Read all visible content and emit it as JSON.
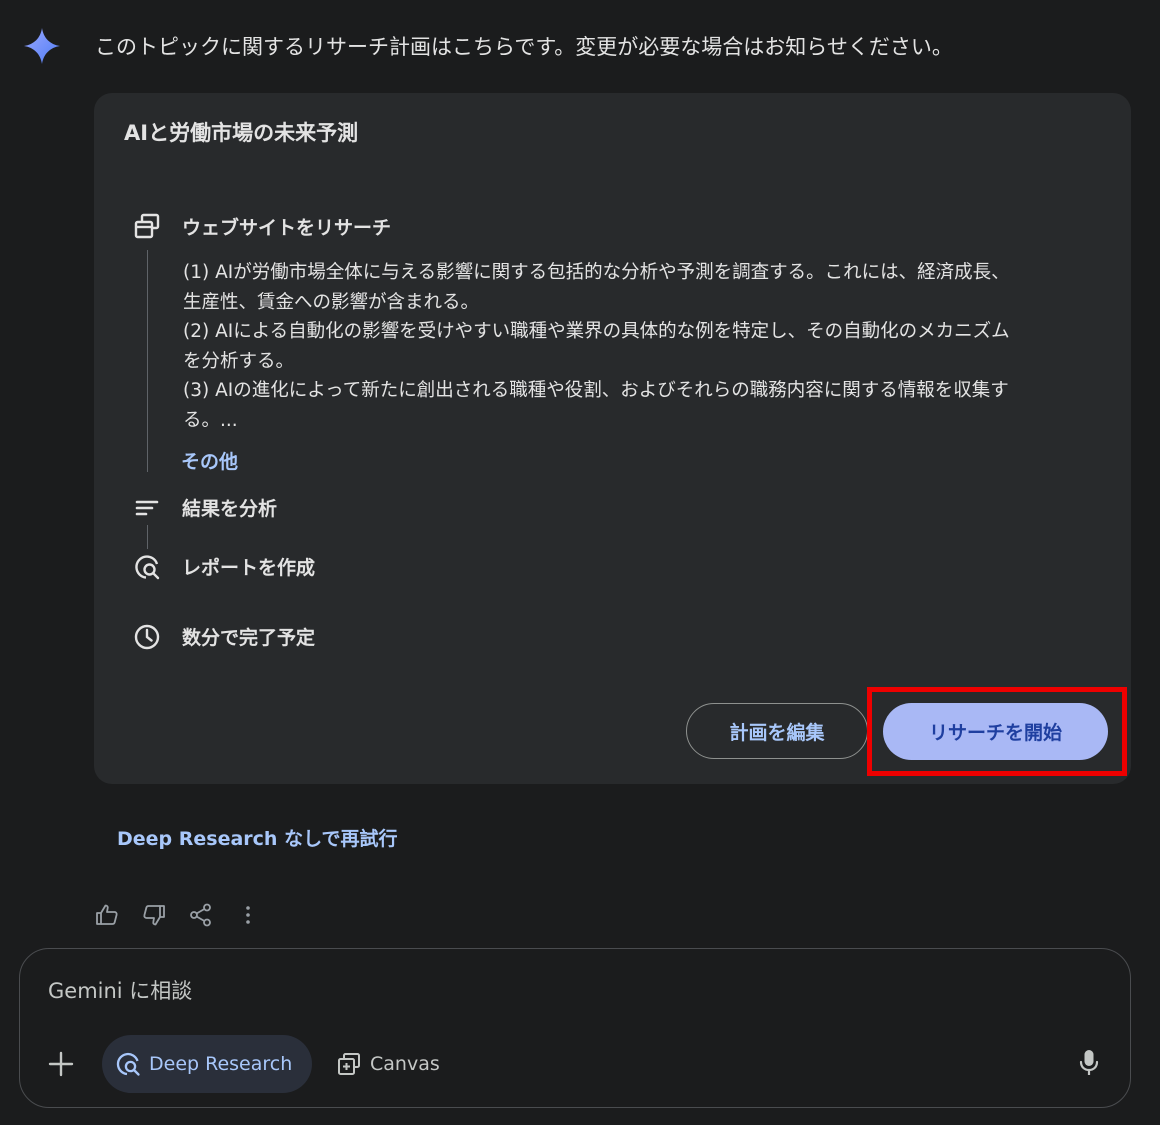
{
  "response": {
    "intro": "このトピックに関するリサーチ計画はこちらです。変更が必要な場合はお知らせください。"
  },
  "plan": {
    "title": "AIと労働市場の未来予測",
    "steps": [
      {
        "label": "ウェブサイトをリサーチ",
        "icon": "web-pages-icon"
      },
      {
        "label": "結果を分析",
        "icon": "analysis-lines-icon"
      },
      {
        "label": "レポートを作成",
        "icon": "report-search-icon"
      }
    ],
    "details": [
      "(1) AIが労働市場全体に与える影響に関する包括的な分析や予測を調査する。これには、経済成長、",
      "生産性、賃金への影響が含まれる。",
      "(2) AIによる自動化の影響を受けやすい職種や業界の具体的な例を特定し、その自動化のメカニズム",
      "を分析する。",
      "(3) AIの進化によって新たに創出される職種や役割、およびそれらの職務内容に関する情報を収集す",
      "る。..."
    ],
    "more_label": "その他",
    "eta": {
      "label": "数分で完了予定",
      "icon": "clock-icon"
    },
    "edit_button": "計画を編集",
    "start_button": "リサーチを開始"
  },
  "retry_link": "Deep Research なしで再試行",
  "actions": [
    "thumbs-up-icon",
    "thumbs-down-icon",
    "share-icon",
    "more-vert-icon"
  ],
  "input": {
    "placeholder": "Gemini に相談",
    "tools": [
      {
        "label": "Deep Research",
        "icon": "deep-research-icon",
        "active": true
      },
      {
        "label": "Canvas",
        "icon": "canvas-icon",
        "active": false
      }
    ]
  },
  "colors": {
    "background": "#1b1c1d",
    "card": "#282a2c",
    "link": "#a8c7fa",
    "primary_button": "#a9b8f5",
    "highlight": "#ee0000"
  }
}
